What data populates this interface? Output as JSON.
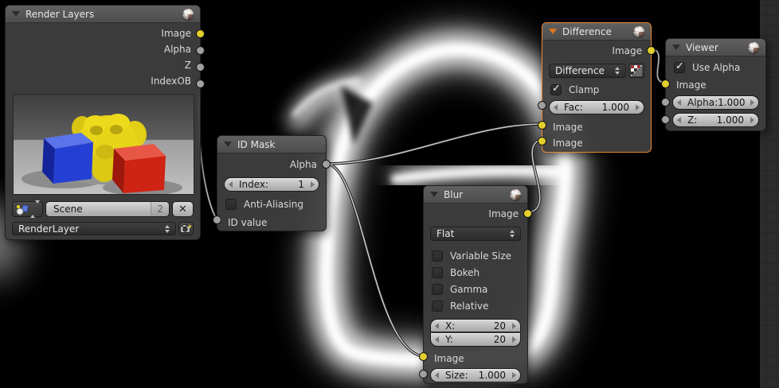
{
  "colors": {
    "selected_border": "#e8872e",
    "socket_image": "#e2cf2d",
    "socket_value": "#a0a0a0",
    "wire": "#c9c9c9",
    "backdrop_bg": "#000000",
    "glow": "#ffffff"
  },
  "nodes": {
    "render_layers": {
      "title": "Render Layers",
      "outputs": [
        "Image",
        "Alpha",
        "Z",
        "IndexOB"
      ],
      "scene": {
        "value": "Scene",
        "count": "2",
        "clear_label": "✕"
      },
      "layer": {
        "value": "RenderLayer"
      }
    },
    "id_mask": {
      "title": "ID Mask",
      "output": "Alpha",
      "index": {
        "label": "Index:",
        "value": "1"
      },
      "anti_aliasing": "Anti-Aliasing",
      "input": "ID value"
    },
    "blur": {
      "title": "Blur",
      "output": "Image",
      "filter_type": "Flat",
      "checkboxes": [
        "Variable Size",
        "Bokeh",
        "Gamma",
        "Relative"
      ],
      "x": {
        "label": "X:",
        "value": "20"
      },
      "y": {
        "label": "Y:",
        "value": "20"
      },
      "image_input": "Image",
      "size": {
        "label": "Size:",
        "value": "1.000"
      }
    },
    "difference": {
      "title": "Difference",
      "output": "Image",
      "mode": "Difference",
      "clamp": "Clamp",
      "fac": {
        "label": "Fac:",
        "value": "1.000"
      },
      "inputs": [
        "Image",
        "Image"
      ]
    },
    "viewer": {
      "title": "Viewer",
      "use_alpha": "Use Alpha",
      "image_input": "Image",
      "alpha": {
        "label": "Alpha:",
        "value": "1.000"
      },
      "z": {
        "label": "Z:",
        "value": "1.000"
      }
    }
  }
}
